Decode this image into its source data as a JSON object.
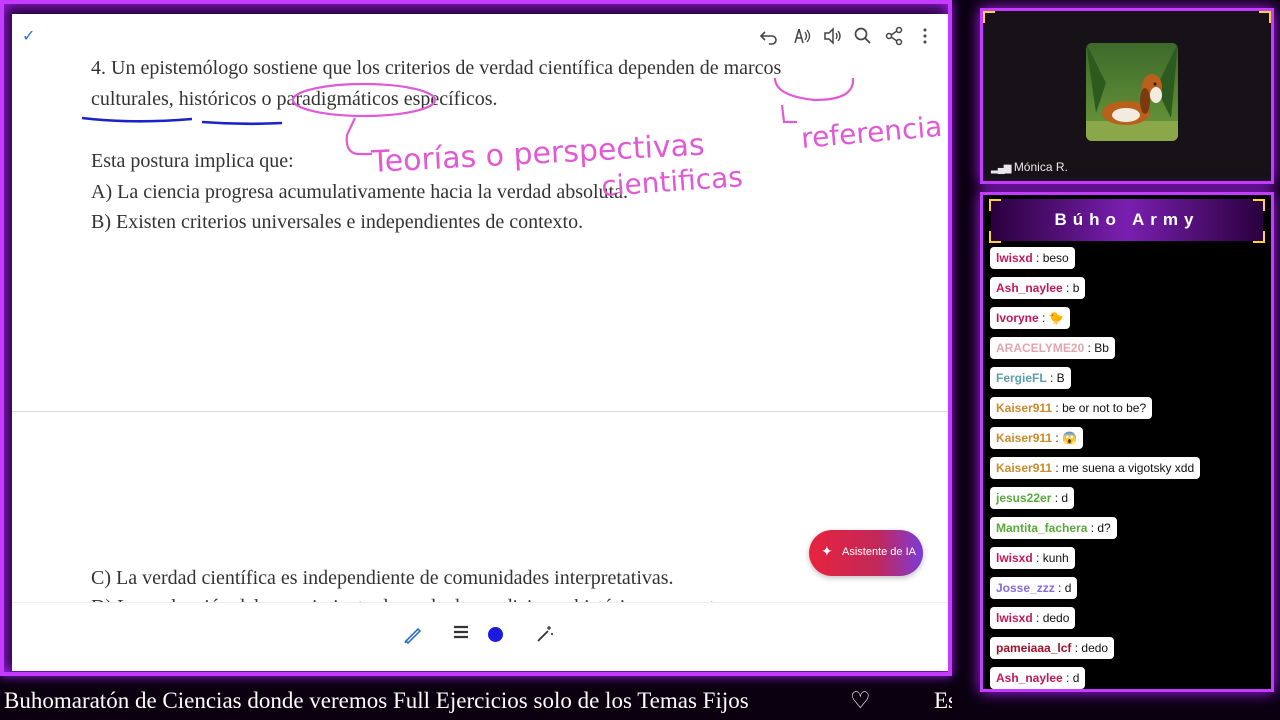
{
  "toolbar": {
    "check_glyph": "✓",
    "icons": [
      "undo-icon",
      "read-aloud-icon",
      "speaker-icon",
      "search-icon",
      "share-icon",
      "more-icon"
    ]
  },
  "document": {
    "q_line1": "4. Un epistemólogo sostiene que los criterios de verdad científica dependen de marcos",
    "q_line2": "culturales, históricos o paradigmáticos específicos.",
    "prompt": "Esta postura implica que:",
    "option_a": "A) La ciencia progresa acumulativamente hacia la verdad absoluta.",
    "option_b": "B) Existen criterios universales e independientes de contexto.",
    "option_c": "C) La verdad científica es independiente de comunidades interpretativas.",
    "option_d_partial": "D) La evaluación del conocimiento depende de condiciones históricas concretas."
  },
  "handwriting": {
    "note1": "Teorías o perspectivas",
    "note2": "cientificas",
    "note3": "referencia",
    "color": "#e05ad6",
    "underline_color": "#1a22c8"
  },
  "ai_button": {
    "label": "Asistente de IA"
  },
  "bottom_tools": [
    "pen-icon",
    "lines-icon",
    "color-dot",
    "magic-icon"
  ],
  "ticker": {
    "text": "Buhomaratón de Ciencias donde veremos Full Ejercicios solo de los Temas Fijos",
    "heart": "♡",
    "trail": "Es"
  },
  "camera": {
    "name": "Mónica R."
  },
  "chat": {
    "title": "Búho Army",
    "messages": [
      {
        "user": "lwisxd",
        "text": ": beso",
        "color": "#c2185b"
      },
      {
        "user": "Ash_naylee",
        "text": ": b",
        "color": "#c2185b"
      },
      {
        "user": "Ivoryne",
        "text": ":",
        "color": "#c2185b",
        "emote": "🐤"
      },
      {
        "user": "ARACELYME20",
        "text": ": Bb",
        "color": "#e0a6b0"
      },
      {
        "user": "FergieFL",
        "text": ": B",
        "color": "#5aa0a8"
      },
      {
        "user": "Kaiser911",
        "text": ": be or not to be?",
        "color": "#c98a2a"
      },
      {
        "user": "Kaiser911",
        "text": ":",
        "color": "#c98a2a",
        "emote": "😱"
      },
      {
        "user": "Kaiser911",
        "text": ": me suena a vigotsky xdd",
        "color": "#c98a2a"
      },
      {
        "user": "jesus22er",
        "text": ": d",
        "color": "#5aa83a"
      },
      {
        "user": "Mantita_fachera",
        "text": ": d?",
        "color": "#5aa83a"
      },
      {
        "user": "lwisxd",
        "text": ": kunh",
        "color": "#c2185b"
      },
      {
        "user": "Josse_zzz",
        "text": ": d",
        "color": "#8a6ad8"
      },
      {
        "user": "lwisxd",
        "text": ": dedo",
        "color": "#c2185b"
      },
      {
        "user": "pameiaaa_lcf",
        "text": ": dedo",
        "color": "#a0102a"
      },
      {
        "user": "Ash_naylee",
        "text": ": d",
        "color": "#c2185b"
      }
    ]
  }
}
